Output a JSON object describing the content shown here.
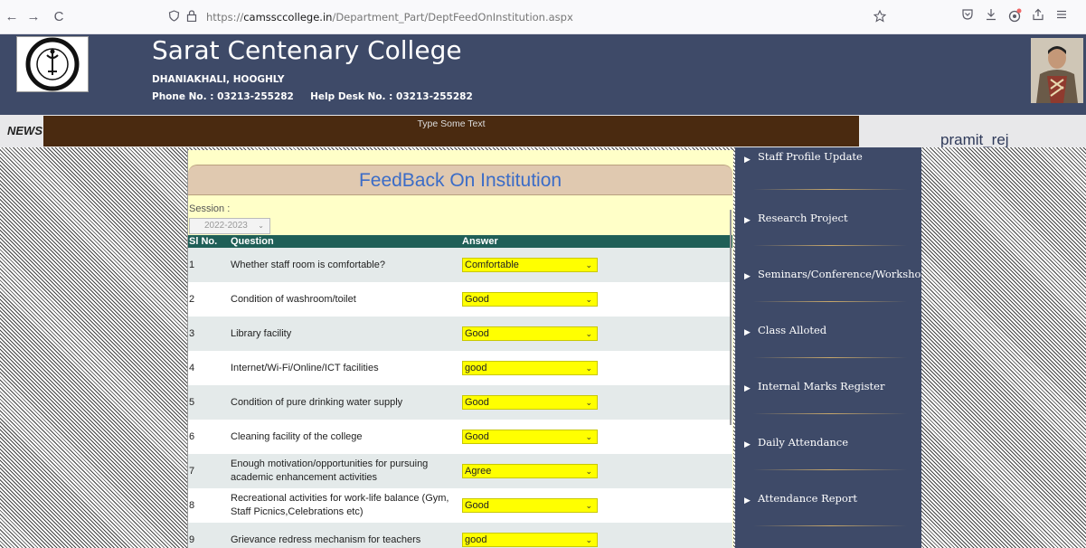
{
  "browser": {
    "back": "←",
    "forward": "→",
    "reload": "C",
    "url_prefix": "https://",
    "url_domain": "camssccollege.in",
    "url_path": "/Department_Part/DeptFeedOnInstitution.aspx"
  },
  "header": {
    "college_name": "Sarat Centenary College",
    "address": "DHANIAKHALI, HOOGHLY",
    "phone": "Phone No. : 03213-255282     Help Desk No. : 03213-255282",
    "bg_color": "#3e4a68"
  },
  "news": {
    "label": "NEWS",
    "text": "Type Some Text"
  },
  "user": {
    "name": "pramit_rej"
  },
  "feedback": {
    "title": "FeedBack On Institution",
    "session_label": "Session :",
    "session_value": "2022-2023",
    "columns": [
      "Sl No.",
      "Question",
      "Answer"
    ],
    "rows": [
      {
        "sl": "1",
        "question": "Whether staff room is comfortable?",
        "answer": "Comfortable"
      },
      {
        "sl": "2",
        "question": "Condition of washroom/toilet",
        "answer": "Good"
      },
      {
        "sl": "3",
        "question": "Library facility",
        "answer": "Good"
      },
      {
        "sl": "4",
        "question": "Internet/Wi-Fi/Online/ICT facilities",
        "answer": "good"
      },
      {
        "sl": "5",
        "question": "Condition of pure drinking water supply",
        "answer": "Good"
      },
      {
        "sl": "6",
        "question": "Cleaning facility of the college",
        "answer": "Good"
      },
      {
        "sl": "7",
        "question": "Enough motivation/opportunities for pursuing academic enhancement activities",
        "answer": "Agree"
      },
      {
        "sl": "8",
        "question": "Recreational activities for work-life balance (Gym, Staff Picnics,Celebrations etc)",
        "answer": "Good"
      },
      {
        "sl": "9",
        "question": "Grievance redress mechanism for teachers",
        "answer": "good"
      }
    ]
  },
  "menu": {
    "items": [
      "Staff Profile Update",
      "Research Project",
      "Seminars/Conference/Workshop",
      "Class Alloted",
      "Internal Marks Register",
      "Daily Attendance",
      "Attendance Report"
    ]
  }
}
